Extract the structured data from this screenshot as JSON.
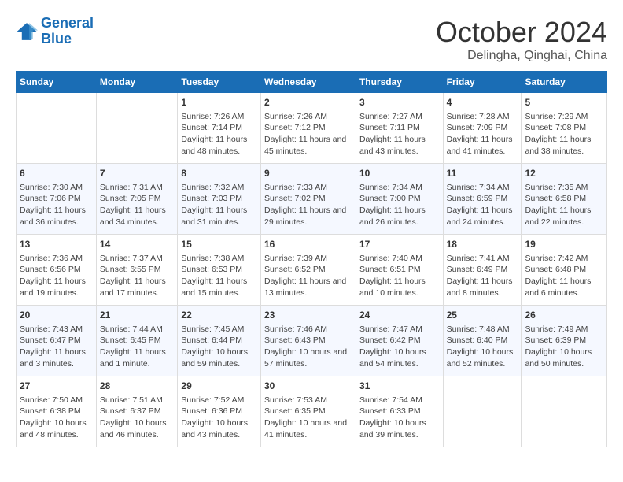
{
  "header": {
    "logo_line1": "General",
    "logo_line2": "Blue",
    "month": "October 2024",
    "location": "Delingha, Qinghai, China"
  },
  "days_of_week": [
    "Sunday",
    "Monday",
    "Tuesday",
    "Wednesday",
    "Thursday",
    "Friday",
    "Saturday"
  ],
  "weeks": [
    [
      {
        "day": "",
        "info": ""
      },
      {
        "day": "",
        "info": ""
      },
      {
        "day": "1",
        "info": "Sunrise: 7:26 AM\nSunset: 7:14 PM\nDaylight: 11 hours\nand 48 minutes."
      },
      {
        "day": "2",
        "info": "Sunrise: 7:26 AM\nSunset: 7:12 PM\nDaylight: 11 hours\nand 45 minutes."
      },
      {
        "day": "3",
        "info": "Sunrise: 7:27 AM\nSunset: 7:11 PM\nDaylight: 11 hours\nand 43 minutes."
      },
      {
        "day": "4",
        "info": "Sunrise: 7:28 AM\nSunset: 7:09 PM\nDaylight: 11 hours\nand 41 minutes."
      },
      {
        "day": "5",
        "info": "Sunrise: 7:29 AM\nSunset: 7:08 PM\nDaylight: 11 hours\nand 38 minutes."
      }
    ],
    [
      {
        "day": "6",
        "info": "Sunrise: 7:30 AM\nSunset: 7:06 PM\nDaylight: 11 hours\nand 36 minutes."
      },
      {
        "day": "7",
        "info": "Sunrise: 7:31 AM\nSunset: 7:05 PM\nDaylight: 11 hours\nand 34 minutes."
      },
      {
        "day": "8",
        "info": "Sunrise: 7:32 AM\nSunset: 7:03 PM\nDaylight: 11 hours\nand 31 minutes."
      },
      {
        "day": "9",
        "info": "Sunrise: 7:33 AM\nSunset: 7:02 PM\nDaylight: 11 hours\nand 29 minutes."
      },
      {
        "day": "10",
        "info": "Sunrise: 7:34 AM\nSunset: 7:00 PM\nDaylight: 11 hours\nand 26 minutes."
      },
      {
        "day": "11",
        "info": "Sunrise: 7:34 AM\nSunset: 6:59 PM\nDaylight: 11 hours\nand 24 minutes."
      },
      {
        "day": "12",
        "info": "Sunrise: 7:35 AM\nSunset: 6:58 PM\nDaylight: 11 hours\nand 22 minutes."
      }
    ],
    [
      {
        "day": "13",
        "info": "Sunrise: 7:36 AM\nSunset: 6:56 PM\nDaylight: 11 hours\nand 19 minutes."
      },
      {
        "day": "14",
        "info": "Sunrise: 7:37 AM\nSunset: 6:55 PM\nDaylight: 11 hours\nand 17 minutes."
      },
      {
        "day": "15",
        "info": "Sunrise: 7:38 AM\nSunset: 6:53 PM\nDaylight: 11 hours\nand 15 minutes."
      },
      {
        "day": "16",
        "info": "Sunrise: 7:39 AM\nSunset: 6:52 PM\nDaylight: 11 hours\nand 13 minutes."
      },
      {
        "day": "17",
        "info": "Sunrise: 7:40 AM\nSunset: 6:51 PM\nDaylight: 11 hours\nand 10 minutes."
      },
      {
        "day": "18",
        "info": "Sunrise: 7:41 AM\nSunset: 6:49 PM\nDaylight: 11 hours\nand 8 minutes."
      },
      {
        "day": "19",
        "info": "Sunrise: 7:42 AM\nSunset: 6:48 PM\nDaylight: 11 hours\nand 6 minutes."
      }
    ],
    [
      {
        "day": "20",
        "info": "Sunrise: 7:43 AM\nSunset: 6:47 PM\nDaylight: 11 hours\nand 3 minutes."
      },
      {
        "day": "21",
        "info": "Sunrise: 7:44 AM\nSunset: 6:45 PM\nDaylight: 11 hours\nand 1 minute."
      },
      {
        "day": "22",
        "info": "Sunrise: 7:45 AM\nSunset: 6:44 PM\nDaylight: 10 hours\nand 59 minutes."
      },
      {
        "day": "23",
        "info": "Sunrise: 7:46 AM\nSunset: 6:43 PM\nDaylight: 10 hours\nand 57 minutes."
      },
      {
        "day": "24",
        "info": "Sunrise: 7:47 AM\nSunset: 6:42 PM\nDaylight: 10 hours\nand 54 minutes."
      },
      {
        "day": "25",
        "info": "Sunrise: 7:48 AM\nSunset: 6:40 PM\nDaylight: 10 hours\nand 52 minutes."
      },
      {
        "day": "26",
        "info": "Sunrise: 7:49 AM\nSunset: 6:39 PM\nDaylight: 10 hours\nand 50 minutes."
      }
    ],
    [
      {
        "day": "27",
        "info": "Sunrise: 7:50 AM\nSunset: 6:38 PM\nDaylight: 10 hours\nand 48 minutes."
      },
      {
        "day": "28",
        "info": "Sunrise: 7:51 AM\nSunset: 6:37 PM\nDaylight: 10 hours\nand 46 minutes."
      },
      {
        "day": "29",
        "info": "Sunrise: 7:52 AM\nSunset: 6:36 PM\nDaylight: 10 hours\nand 43 minutes."
      },
      {
        "day": "30",
        "info": "Sunrise: 7:53 AM\nSunset: 6:35 PM\nDaylight: 10 hours\nand 41 minutes."
      },
      {
        "day": "31",
        "info": "Sunrise: 7:54 AM\nSunset: 6:33 PM\nDaylight: 10 hours\nand 39 minutes."
      },
      {
        "day": "",
        "info": ""
      },
      {
        "day": "",
        "info": ""
      }
    ]
  ]
}
